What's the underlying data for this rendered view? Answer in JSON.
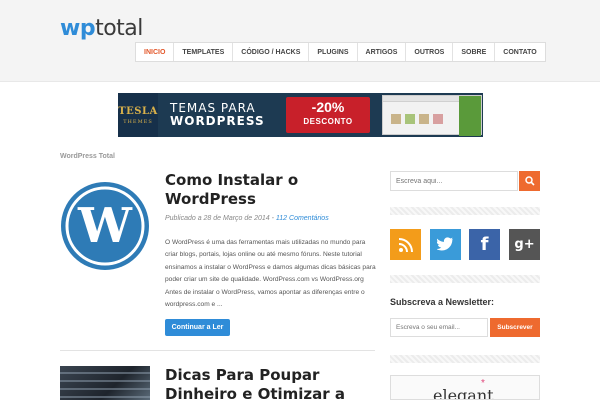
{
  "header": {
    "logo_wp": "wp",
    "logo_total": "total",
    "nav": [
      "INICIO",
      "TEMPLATES",
      "CÓDIGO / HACKS",
      "PLUGINS",
      "ARTIGOS",
      "OUTROS",
      "SOBRE",
      "CONTATO"
    ],
    "active_nav": "INICIO"
  },
  "banner": {
    "brand_line1": "TESLA",
    "brand_line2": "THEMES",
    "text_line1": "TEMAS PARA",
    "text_line2": "WORDPRESS",
    "discount": "-20%",
    "discount_label": "DESCONTO"
  },
  "breadcrumb": "WordPress Total",
  "post1": {
    "title": "Como Instalar o WordPress",
    "meta_prefix": "Publicado a 28 de Março de 2014 - ",
    "comments": "112 Comentários",
    "excerpt": "O WordPress é uma das ferramentas mais utilizadas no mundo para criar blogs, portais, lojas online ou até mesmo fóruns. Neste tutorial ensinamos a instalar o WordPress e damos algumas dicas básicas para poder criar um site de qualidade. WordPress.com vs WordPress.org Antes de instalar o WordPress, vamos apontar as diferenças entre o wordpress.com e ...",
    "read_more": "Continuar a Ler",
    "thumb_icon": "wordpress-logo-icon"
  },
  "post2": {
    "title": "Dicas Para Poupar Dinheiro e Otimizar a"
  },
  "sidebar": {
    "search_placeholder": "Escreva aqui...",
    "social": [
      {
        "name": "rss",
        "color": "#f39c1a"
      },
      {
        "name": "twitter",
        "color": "#3a9bd9"
      },
      {
        "name": "facebook",
        "color": "#3b64a8"
      },
      {
        "name": "google-plus",
        "color": "#555555",
        "glyph": "g+"
      }
    ],
    "newsletter_title": "Subscreva a Newsletter:",
    "newsletter_placeholder": "Escreva o seu email...",
    "newsletter_button": "Subscrever",
    "ad_text": "elegant"
  },
  "colors": {
    "accent_orange": "#ee6a2f",
    "link_blue": "#2f8cd8"
  }
}
